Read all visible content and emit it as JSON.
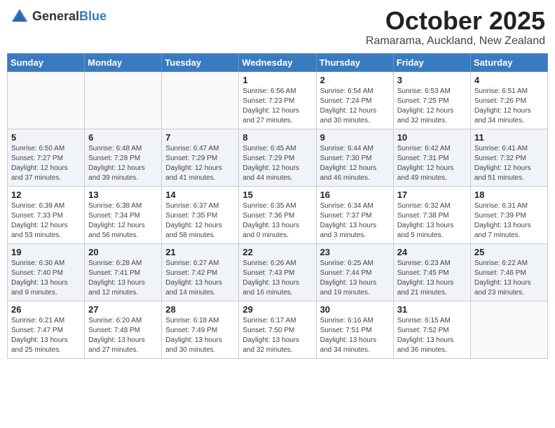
{
  "header": {
    "logo_general": "General",
    "logo_blue": "Blue",
    "month_title": "October 2025",
    "location": "Ramarama, Auckland, New Zealand"
  },
  "weekdays": [
    "Sunday",
    "Monday",
    "Tuesday",
    "Wednesday",
    "Thursday",
    "Friday",
    "Saturday"
  ],
  "weeks": [
    [
      {
        "day": "",
        "info": ""
      },
      {
        "day": "",
        "info": ""
      },
      {
        "day": "",
        "info": ""
      },
      {
        "day": "1",
        "info": "Sunrise: 6:56 AM\nSunset: 7:23 PM\nDaylight: 12 hours\nand 27 minutes."
      },
      {
        "day": "2",
        "info": "Sunrise: 6:54 AM\nSunset: 7:24 PM\nDaylight: 12 hours\nand 30 minutes."
      },
      {
        "day": "3",
        "info": "Sunrise: 6:53 AM\nSunset: 7:25 PM\nDaylight: 12 hours\nand 32 minutes."
      },
      {
        "day": "4",
        "info": "Sunrise: 6:51 AM\nSunset: 7:26 PM\nDaylight: 12 hours\nand 34 minutes."
      }
    ],
    [
      {
        "day": "5",
        "info": "Sunrise: 6:50 AM\nSunset: 7:27 PM\nDaylight: 12 hours\nand 37 minutes."
      },
      {
        "day": "6",
        "info": "Sunrise: 6:48 AM\nSunset: 7:28 PM\nDaylight: 12 hours\nand 39 minutes."
      },
      {
        "day": "7",
        "info": "Sunrise: 6:47 AM\nSunset: 7:29 PM\nDaylight: 12 hours\nand 41 minutes."
      },
      {
        "day": "8",
        "info": "Sunrise: 6:45 AM\nSunset: 7:29 PM\nDaylight: 12 hours\nand 44 minutes."
      },
      {
        "day": "9",
        "info": "Sunrise: 6:44 AM\nSunset: 7:30 PM\nDaylight: 12 hours\nand 46 minutes."
      },
      {
        "day": "10",
        "info": "Sunrise: 6:42 AM\nSunset: 7:31 PM\nDaylight: 12 hours\nand 49 minutes."
      },
      {
        "day": "11",
        "info": "Sunrise: 6:41 AM\nSunset: 7:32 PM\nDaylight: 12 hours\nand 51 minutes."
      }
    ],
    [
      {
        "day": "12",
        "info": "Sunrise: 6:39 AM\nSunset: 7:33 PM\nDaylight: 12 hours\nand 53 minutes."
      },
      {
        "day": "13",
        "info": "Sunrise: 6:38 AM\nSunset: 7:34 PM\nDaylight: 12 hours\nand 56 minutes."
      },
      {
        "day": "14",
        "info": "Sunrise: 6:37 AM\nSunset: 7:35 PM\nDaylight: 12 hours\nand 58 minutes."
      },
      {
        "day": "15",
        "info": "Sunrise: 6:35 AM\nSunset: 7:36 PM\nDaylight: 13 hours\nand 0 minutes."
      },
      {
        "day": "16",
        "info": "Sunrise: 6:34 AM\nSunset: 7:37 PM\nDaylight: 13 hours\nand 3 minutes."
      },
      {
        "day": "17",
        "info": "Sunrise: 6:32 AM\nSunset: 7:38 PM\nDaylight: 13 hours\nand 5 minutes."
      },
      {
        "day": "18",
        "info": "Sunrise: 6:31 AM\nSunset: 7:39 PM\nDaylight: 13 hours\nand 7 minutes."
      }
    ],
    [
      {
        "day": "19",
        "info": "Sunrise: 6:30 AM\nSunset: 7:40 PM\nDaylight: 13 hours\nand 9 minutes."
      },
      {
        "day": "20",
        "info": "Sunrise: 6:28 AM\nSunset: 7:41 PM\nDaylight: 13 hours\nand 12 minutes."
      },
      {
        "day": "21",
        "info": "Sunrise: 6:27 AM\nSunset: 7:42 PM\nDaylight: 13 hours\nand 14 minutes."
      },
      {
        "day": "22",
        "info": "Sunrise: 6:26 AM\nSunset: 7:43 PM\nDaylight: 13 hours\nand 16 minutes."
      },
      {
        "day": "23",
        "info": "Sunrise: 6:25 AM\nSunset: 7:44 PM\nDaylight: 13 hours\nand 19 minutes."
      },
      {
        "day": "24",
        "info": "Sunrise: 6:23 AM\nSunset: 7:45 PM\nDaylight: 13 hours\nand 21 minutes."
      },
      {
        "day": "25",
        "info": "Sunrise: 6:22 AM\nSunset: 7:46 PM\nDaylight: 13 hours\nand 23 minutes."
      }
    ],
    [
      {
        "day": "26",
        "info": "Sunrise: 6:21 AM\nSunset: 7:47 PM\nDaylight: 13 hours\nand 25 minutes."
      },
      {
        "day": "27",
        "info": "Sunrise: 6:20 AM\nSunset: 7:48 PM\nDaylight: 13 hours\nand 27 minutes."
      },
      {
        "day": "28",
        "info": "Sunrise: 6:18 AM\nSunset: 7:49 PM\nDaylight: 13 hours\nand 30 minutes."
      },
      {
        "day": "29",
        "info": "Sunrise: 6:17 AM\nSunset: 7:50 PM\nDaylight: 13 hours\nand 32 minutes."
      },
      {
        "day": "30",
        "info": "Sunrise: 6:16 AM\nSunset: 7:51 PM\nDaylight: 13 hours\nand 34 minutes."
      },
      {
        "day": "31",
        "info": "Sunrise: 6:15 AM\nSunset: 7:52 PM\nDaylight: 13 hours\nand 36 minutes."
      },
      {
        "day": "",
        "info": ""
      }
    ]
  ]
}
